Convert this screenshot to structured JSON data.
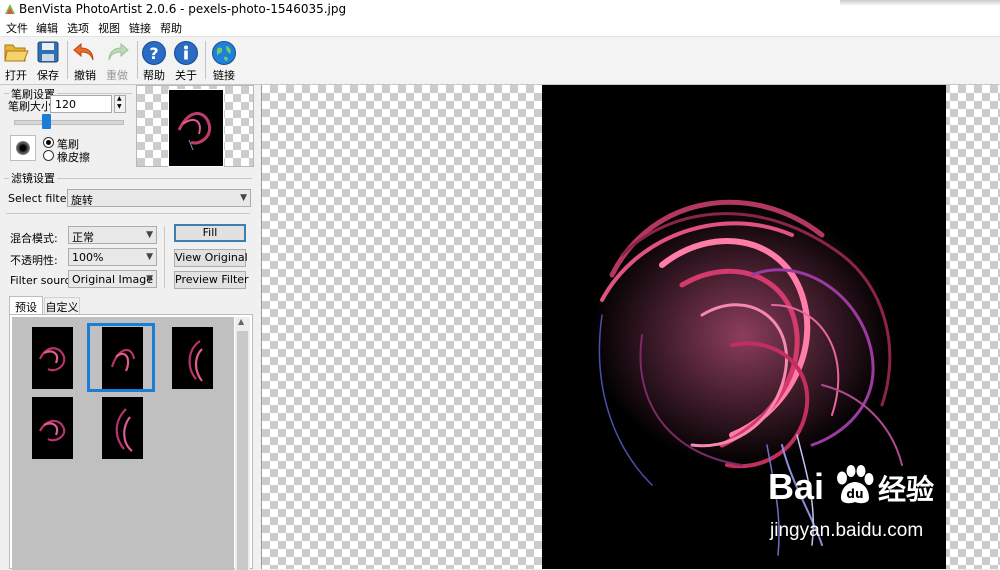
{
  "window": {
    "title": "BenVista PhotoArtist 2.0.6 - pexels-photo-1546035.jpg"
  },
  "menu": [
    "文件",
    "编辑",
    "选项",
    "视图",
    "链接",
    "帮助"
  ],
  "toolbar": {
    "open": "打开",
    "save": "保存",
    "undo": "撤销",
    "redo": "重做",
    "help": "帮助",
    "about": "关于",
    "link": "链接"
  },
  "brush": {
    "group_title": "笔刷设置",
    "size_label": "笔刷大小:",
    "size_value": "120",
    "slider_level": 0.3,
    "mode_brush": "笔刷",
    "mode_eraser": "橡皮擦",
    "selected_mode": "brush"
  },
  "filter": {
    "group_title": "滤镜设置",
    "select_label": "Select filter:",
    "selected_filter": "旋转",
    "blend_label": "混合模式:",
    "blend_value": "正常",
    "opacity_label": "不透明性:",
    "opacity_value": "100%",
    "source_label": "Filter source:",
    "source_value": "Original Image",
    "fill_button": "Fill",
    "view_original_button": "View Original",
    "preview_filter_button": "Preview Filter"
  },
  "tabs": {
    "preset": "预设",
    "custom": "自定义",
    "active": "preset"
  },
  "presets": {
    "count": 5,
    "selected_index": 1
  },
  "watermark": {
    "brand_latin": "Bai",
    "brand_cn": "经验",
    "url": "jingyan.baidu.com"
  },
  "colors": {
    "selection": "#1a7fd4",
    "default_button_border": "#3c7fb1",
    "canvas_bg": "#000000"
  }
}
